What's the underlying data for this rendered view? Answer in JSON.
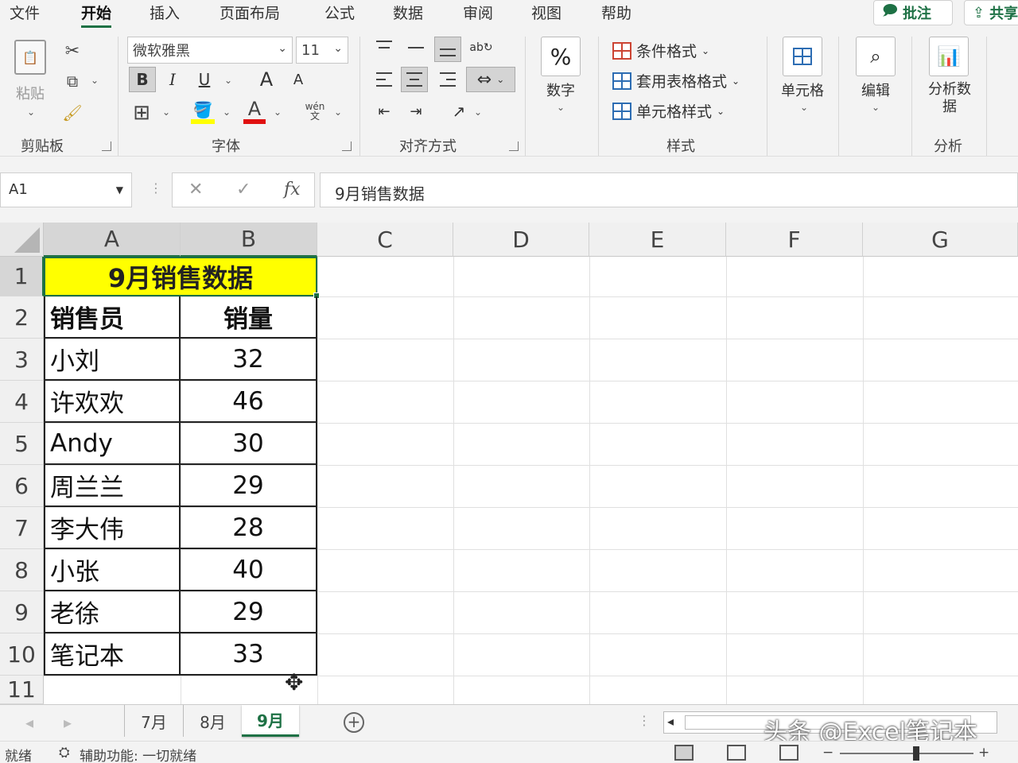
{
  "tabs": [
    "文件",
    "开始",
    "插入",
    "页面布局",
    "公式",
    "数据",
    "审阅",
    "视图",
    "帮助"
  ],
  "tab_buttons": {
    "comment": "批注",
    "share": "共享"
  },
  "ribbon": {
    "clipboard": {
      "label": "剪贴板",
      "paste": "粘贴"
    },
    "font": {
      "label": "字体",
      "name": "微软雅黑",
      "size": "11",
      "bold": "B",
      "italic": "I",
      "underline": "U",
      "grow": "A",
      "shrink": "A",
      "wen": "wén"
    },
    "alignment": {
      "label": "对齐方式"
    },
    "number": {
      "label": "数字",
      "symbol": "%"
    },
    "styles": {
      "label": "样式",
      "conditional": "条件格式",
      "table": "套用表格格式",
      "cell": "单元格样式"
    },
    "cells": {
      "label": "单元格"
    },
    "editing": {
      "label": "编辑"
    },
    "analysis": {
      "label": "分析",
      "button": "分析数据"
    }
  },
  "formula_bar": {
    "name_box": "A1",
    "value": "9月销售数据",
    "fx": "fx"
  },
  "columns": [
    "A",
    "B",
    "C",
    "D",
    "E",
    "F",
    "G"
  ],
  "rows": [
    "1",
    "2",
    "3",
    "4",
    "5",
    "6",
    "7",
    "8",
    "9",
    "10",
    "11"
  ],
  "sheet": {
    "title": "9月销售数据",
    "headers": [
      "销售员",
      "销量"
    ],
    "data": [
      [
        "小刘",
        "32"
      ],
      [
        "许欢欢",
        "46"
      ],
      [
        "Andy",
        "30"
      ],
      [
        "周兰兰",
        "29"
      ],
      [
        "李大伟",
        "28"
      ],
      [
        "小张",
        "40"
      ],
      [
        "老徐",
        "29"
      ],
      [
        "笔记本",
        "33"
      ]
    ]
  },
  "sheet_tabs": [
    "7月",
    "8月",
    "9月"
  ],
  "active_sheet": "9月",
  "watermark": "头条 @Excel笔记本",
  "status": {
    "ready": "就绪",
    "accessibility": "辅助功能: 一切就绪"
  },
  "colors": {
    "accent": "#1e7145",
    "title_fill": "#ffff00"
  }
}
